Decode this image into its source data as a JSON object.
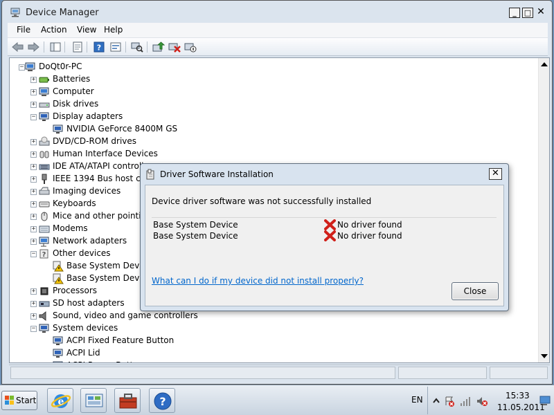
{
  "window": {
    "title": "Device Manager",
    "min_glyph": "_",
    "max_glyph": "□",
    "close_glyph": "✕"
  },
  "menu": [
    "File",
    "Action",
    "View",
    "Help"
  ],
  "tree": {
    "root": "DoQt0r-PC",
    "items": [
      {
        "label": "Batteries",
        "icon": "battery-icon",
        "level": 1,
        "expanded": false
      },
      {
        "label": "Computer",
        "icon": "computer-icon",
        "level": 1,
        "expanded": false
      },
      {
        "label": "Disk drives",
        "icon": "disk-drive-icon",
        "level": 1,
        "expanded": false
      },
      {
        "label": "Display adapters",
        "icon": "monitor-icon",
        "level": 1,
        "expanded": true
      },
      {
        "label": "NVIDIA GeForce 8400M GS",
        "icon": "monitor-icon",
        "level": 2
      },
      {
        "label": "DVD/CD-ROM drives",
        "icon": "dvd-drive-icon",
        "level": 1,
        "expanded": false
      },
      {
        "label": "Human Interface Devices",
        "icon": "hid-icon",
        "level": 1,
        "expanded": false
      },
      {
        "label": "IDE ATA/ATAPI controll",
        "icon": "ide-controller-icon",
        "level": 1,
        "expanded": false
      },
      {
        "label": "IEEE 1394 Bus host cont",
        "icon": "ieee1394-icon",
        "level": 1,
        "expanded": false
      },
      {
        "label": "Imaging devices",
        "icon": "scanner-icon",
        "level": 1,
        "expanded": false
      },
      {
        "label": "Keyboards",
        "icon": "keyboard-icon",
        "level": 1,
        "expanded": false
      },
      {
        "label": "Mice and other pointin",
        "icon": "mouse-icon",
        "level": 1,
        "expanded": false
      },
      {
        "label": "Modems",
        "icon": "modem-icon",
        "level": 1,
        "expanded": false
      },
      {
        "label": "Network adapters",
        "icon": "network-adapter-icon",
        "level": 1,
        "expanded": false
      },
      {
        "label": "Other devices",
        "icon": "unknown-device-icon",
        "level": 1,
        "expanded": true
      },
      {
        "label": "Base System Device",
        "icon": "warning-device-icon",
        "level": 2
      },
      {
        "label": "Base System Device",
        "icon": "warning-device-icon",
        "level": 2
      },
      {
        "label": "Processors",
        "icon": "processor-icon",
        "level": 1,
        "expanded": false
      },
      {
        "label": "SD host adapters",
        "icon": "sd-adapter-icon",
        "level": 1,
        "expanded": false
      },
      {
        "label": "Sound, video and game controllers",
        "icon": "speaker-icon",
        "level": 1,
        "expanded": false
      },
      {
        "label": "System devices",
        "icon": "system-device-icon",
        "level": 1,
        "expanded": true
      },
      {
        "label": "ACPI Fixed Feature Button",
        "icon": "system-device-icon",
        "level": 2
      },
      {
        "label": "ACPI Lid",
        "icon": "system-device-icon",
        "level": 2
      },
      {
        "label": "ACPI Power Button",
        "icon": "system-device-icon",
        "level": 2
      }
    ]
  },
  "dialog": {
    "title": "Driver Software Installation",
    "close_glyph": "✕",
    "message": "Device driver software was not successfully installed",
    "devices": [
      {
        "name": "Base System Device",
        "status": "No driver found"
      },
      {
        "name": "Base System Device",
        "status": "No driver found"
      }
    ],
    "link": "What can I do if my device did not install properly?",
    "close_button": "Close"
  },
  "taskbar": {
    "start_label": "Start",
    "language": "EN",
    "time": "15:33",
    "date": "11.05.2011"
  },
  "colors": {
    "link": "#0066cc",
    "error_red": "#d0201a",
    "warning_yellow": "#f5c400",
    "desktop_blue": "#6d8fb3"
  }
}
